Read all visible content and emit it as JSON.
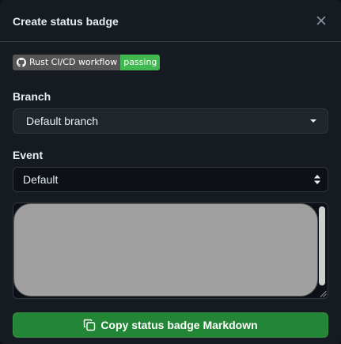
{
  "dialog": {
    "title": "Create status badge",
    "close_icon": "x-icon"
  },
  "badge": {
    "left_text": "Rust CI/CD workflow",
    "right_text": "passing",
    "logo_icon": "github-logo-icon",
    "status_color": "#3fb950"
  },
  "branch": {
    "label": "Branch",
    "selected": "Default branch",
    "icon": "triangle-down-icon"
  },
  "event": {
    "label": "Event",
    "selected": "Default",
    "icon": "chevron-up-down-icon"
  },
  "markdown_area": {
    "value": ""
  },
  "copy_button": {
    "label": "Copy status badge Markdown",
    "icon": "copy-icon",
    "color": "#238636"
  }
}
